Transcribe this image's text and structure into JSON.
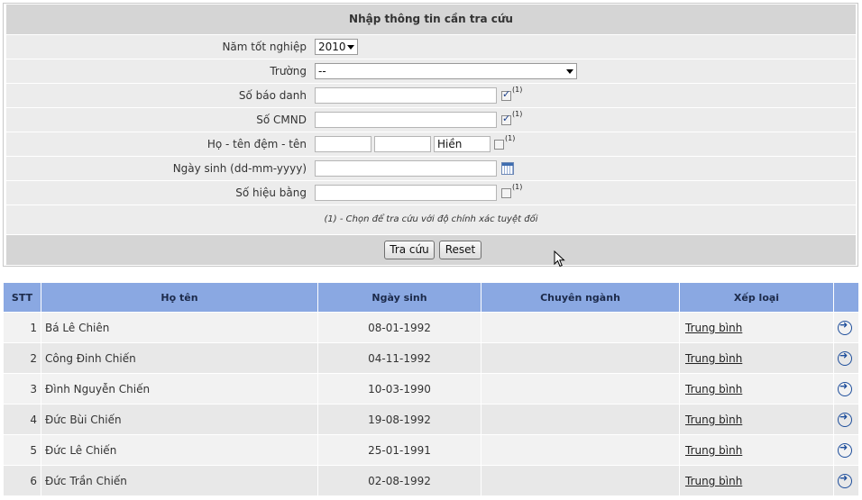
{
  "form": {
    "title": "Nhập thông tin cần tra cứu",
    "fields": {
      "year": {
        "label": "Năm tốt nghiệp",
        "value": "2010"
      },
      "school": {
        "label": "Trường",
        "value": "--"
      },
      "sbd": {
        "label": "Số báo danh",
        "value": "",
        "checked": true,
        "sup": "(1)"
      },
      "cmnd": {
        "label": "Số CMND",
        "value": "",
        "checked": true,
        "sup": "(1)"
      },
      "name": {
        "label": "Họ - tên đệm - tên",
        "ho": "",
        "dem": "",
        "ten": "Hiền",
        "checked": false,
        "sup": "(1)"
      },
      "dob": {
        "label": "Ngày sinh (dd-mm-yyyy)",
        "value": ""
      },
      "diploma": {
        "label": "Số hiệu bằng",
        "value": "",
        "checked": false,
        "sup": "(1)"
      }
    },
    "note": "(1) - Chọn để tra cứu với độ chính xác tuyệt đối",
    "search_button": "Tra cứu",
    "reset_button": "Reset"
  },
  "table": {
    "headers": [
      "STT",
      "Họ tên",
      "Ngày sinh",
      "Chuyên ngành",
      "Xếp loại",
      ""
    ],
    "rows": [
      {
        "stt": "1",
        "name": "Bá Lê Chiên",
        "dob": "08-01-1992",
        "major": "",
        "rank": "Trung bình"
      },
      {
        "stt": "2",
        "name": "Công Đinh Chiến",
        "dob": "04-11-1992",
        "major": "",
        "rank": "Trung bình"
      },
      {
        "stt": "3",
        "name": "Đình Nguyễn Chiến",
        "dob": "10-03-1990",
        "major": "",
        "rank": "Trung bình"
      },
      {
        "stt": "4",
        "name": "Đức Bùi Chiến",
        "dob": "19-08-1992",
        "major": "",
        "rank": "Trung bình"
      },
      {
        "stt": "5",
        "name": "Đức Lê Chiến",
        "dob": "25-01-1991",
        "major": "",
        "rank": "Trung bình"
      },
      {
        "stt": "6",
        "name": "Đức Trần Chiến",
        "dob": "02-08-1992",
        "major": "",
        "rank": "Trung bình"
      }
    ]
  }
}
